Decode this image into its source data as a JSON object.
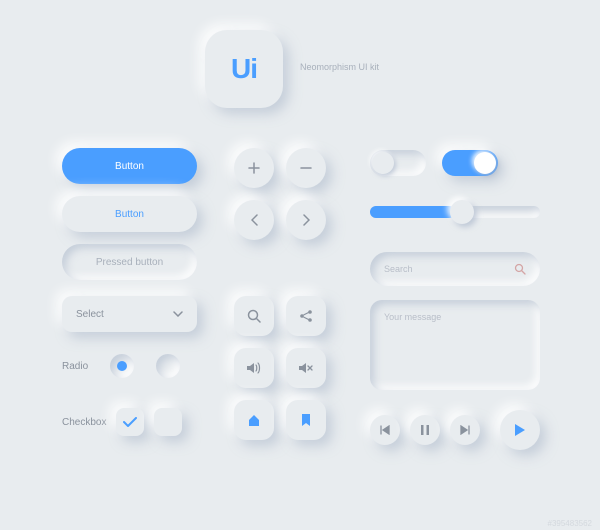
{
  "logo": {
    "text": "Ui"
  },
  "subtitle": "Neomorphism UI kit",
  "buttons": {
    "primary_label": "Button",
    "secondary_label": "Button",
    "pressed_label": "Pressed button"
  },
  "select": {
    "label": "Select"
  },
  "radio": {
    "label": "Radio",
    "selected": 0
  },
  "checkbox": {
    "label": "Checkbox",
    "checked": true
  },
  "toggles": {
    "left_on": false,
    "right_on": true
  },
  "slider": {
    "value": 50,
    "max": 100
  },
  "search": {
    "placeholder": "Search"
  },
  "message": {
    "placeholder": "Your message"
  },
  "colors": {
    "accent": "#4a9eff",
    "muted": "#8a929d",
    "bg": "#e8ecef"
  },
  "icons": {
    "plus": "plus-icon",
    "minus": "minus-icon",
    "prev": "chevron-left-icon",
    "next": "chevron-right-icon",
    "search": "search-icon",
    "share": "share-icon",
    "volume": "volume-icon",
    "mute": "mute-icon",
    "home": "home-icon",
    "bookmark": "bookmark-icon",
    "skip_back": "skip-back-icon",
    "pause": "pause-icon",
    "skip_fwd": "skip-forward-icon",
    "play": "play-icon",
    "chevron_down": "chevron-down-icon",
    "check": "check-icon"
  },
  "watermark": "#395483562"
}
